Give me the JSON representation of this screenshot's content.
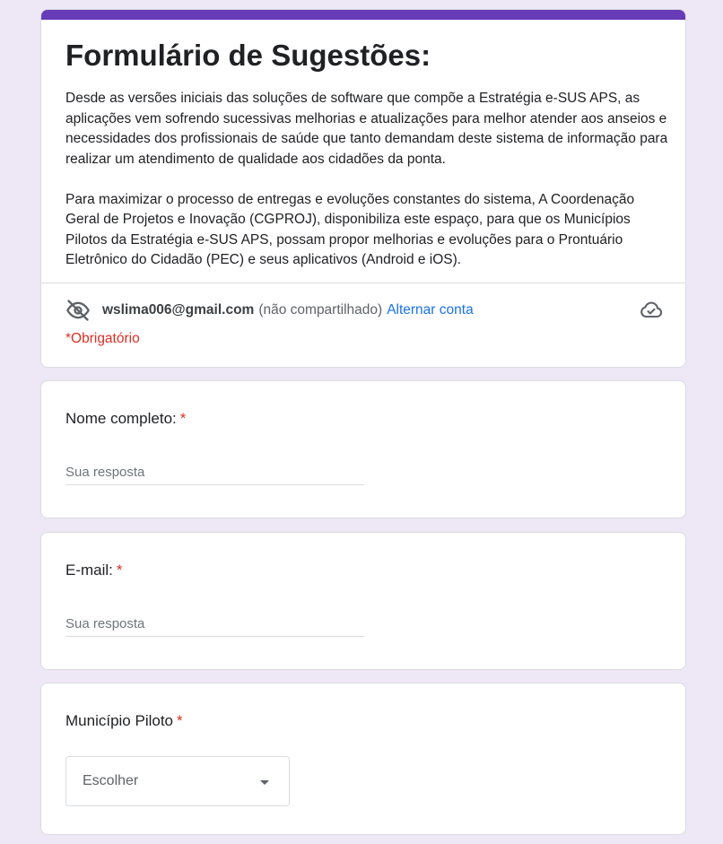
{
  "header": {
    "title": "Formulário de Sugestões:",
    "description_p1": "Desde as versões iniciais das soluções de software que compõe a Estratégia e-SUS APS, as aplicações vem sofrendo sucessivas melhorias e atualizações para melhor atender aos anseios e necessidades dos profissionais de saúde que tanto demandam deste sistema de informação para realizar um atendimento de qualidade aos cidadões da ponta.",
    "description_p2": "Para maximizar o processo de entregas e evoluções constantes do sistema, A Coordenação Geral de Projetos e Inovação (CGPROJ), disponibiliza este espaço, para que os Municípios Pilotos da Estratégia e-SUS APS, possam propor melhorias e evoluções para o Prontuário Eletrônico do Cidadão (PEC) e seus aplicativos (Android e iOS).",
    "accent_color": "#673ab7"
  },
  "account": {
    "email": "wslima006@gmail.com",
    "shared_status": "(não compartilhado)",
    "switch_label": "Alternar conta",
    "icons": [
      "eye-off-icon",
      "cloud-check-icon"
    ]
  },
  "required_note": "*Obrigatório",
  "questions": [
    {
      "label": "Nome completo:",
      "required_mark": "*",
      "placeholder": "Sua resposta"
    },
    {
      "label": "E-mail:",
      "required_mark": "*",
      "placeholder": "Sua resposta"
    },
    {
      "label": "Município Piloto",
      "required_mark": "*",
      "select_value": "Escolher"
    }
  ]
}
